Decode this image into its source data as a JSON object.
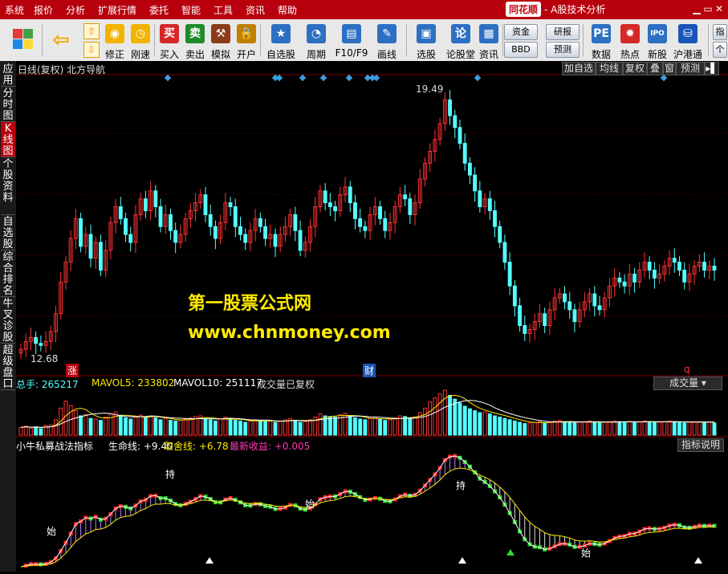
{
  "menubar": {
    "items": [
      "系统",
      "报价",
      "分析",
      "扩展行情",
      "委托",
      "智能",
      "工具",
      "资讯",
      "帮助"
    ],
    "brand_logo": "同花顺",
    "brand_sub": "- A股技术分析"
  },
  "toolbar": {
    "buttons": [
      "修正",
      "刚速",
      "买入",
      "卖出",
      "模拟",
      "开户",
      "自选股",
      "周期",
      "F10/F9",
      "画线",
      "选股",
      "论股堂",
      "资讯",
      "数据",
      "热点",
      "新股",
      "沪港通"
    ],
    "right_buttons": [
      "资金",
      "BBD",
      "研报",
      "预测"
    ],
    "buy_glyph": "买",
    "sell_glyph": "卖",
    "lun_glyph": "论"
  },
  "sidebar": {
    "tabs": [
      "应用",
      "分时图",
      "K线图",
      "个股资料",
      "自选股",
      "综合排名",
      "牛叉诊股",
      "超级盘口"
    ],
    "active_index": 2
  },
  "kline_panel": {
    "title": "日线(复权)  北方导航",
    "right_buttons": [
      "加自选",
      "均线",
      "复权",
      "叠",
      "窗",
      "预测"
    ],
    "high_label": "19.49",
    "low_label": "12.68",
    "marker_zhang": "涨",
    "marker_cai": "财",
    "marker_q": "q"
  },
  "volume_panel": {
    "label_total": "总手: 265217",
    "label_ma5": "MAVOL5: 233802",
    "label_ma10": "MAVOL10: 251117",
    "note": "成交量已复权",
    "dropdown": "成交量"
  },
  "indicator_panel": {
    "name": "小牛私募战法指标",
    "life_line": "生命线: +9.40",
    "exit_line": "取舍线: +6.78",
    "profit": "最新收益: +0.005",
    "help_button": "指标说明",
    "label_hold": "持",
    "label_start": "始"
  },
  "watermark": {
    "line1": "第一股票公式网",
    "line2": "www.chnmoney.com"
  },
  "colors": {
    "up": "#ff3232",
    "down": "#54ffff",
    "menu_bg": "#b8000d",
    "accent_yellow": "#ffeb00"
  },
  "chart_data": {
    "type": "candlestick",
    "price_range": [
      12.68,
      19.49
    ],
    "closes": [
      12.9,
      13.1,
      13.2,
      13.05,
      13.0,
      13.1,
      13.35,
      13.8,
      14.6,
      15.1,
      15.7,
      16.2,
      15.5,
      15.8,
      15.2,
      15.6,
      14.9,
      15.4,
      16.1,
      16.5,
      16.2,
      15.8,
      15.6,
      16.3,
      16.7,
      16.4,
      16.9,
      16.5,
      16.0,
      16.3,
      15.9,
      15.6,
      15.8,
      16.2,
      16.4,
      16.6,
      16.8,
      16.3,
      16.0,
      15.7,
      16.1,
      16.6,
      16.5,
      16.0,
      15.8,
      15.6,
      15.9,
      16.2,
      16.0,
      15.7,
      15.8,
      15.5,
      15.8,
      16.0,
      16.3,
      15.9,
      15.4,
      15.6,
      16.0,
      16.5,
      16.9,
      16.6,
      16.5,
      16.4,
      16.8,
      17.0,
      16.6,
      16.2,
      16.0,
      15.9,
      16.3,
      16.5,
      16.2,
      15.9,
      16.1,
      16.5,
      16.8,
      16.7,
      16.3,
      16.6,
      17.2,
      17.6,
      17.9,
      18.2,
      18.6,
      19.2,
      18.8,
      18.5,
      18.1,
      17.6,
      17.3,
      16.9,
      16.5,
      16.7,
      16.4,
      16.0,
      15.6,
      15.1,
      14.5,
      14.0,
      13.5,
      13.3,
      13.4,
      13.6,
      13.8,
      13.5,
      13.9,
      14.2,
      14.3,
      14.1,
      13.9,
      13.6,
      13.9,
      14.1,
      14.3,
      14.0,
      13.9,
      14.2,
      14.5,
      14.7,
      14.6,
      14.5,
      14.8,
      14.6,
      14.9,
      15.1,
      14.9,
      14.7,
      14.8,
      15.0,
      15.2,
      15.1,
      14.9,
      14.6,
      14.8,
      15.0,
      15.1,
      14.9,
      15.0,
      14.9
    ],
    "volumes": [
      120,
      140,
      110,
      130,
      100,
      150,
      160,
      240,
      420,
      530,
      460,
      380,
      300,
      320,
      260,
      250,
      230,
      280,
      330,
      360,
      310,
      270,
      250,
      290,
      310,
      280,
      300,
      270,
      240,
      260,
      230,
      220,
      230,
      250,
      270,
      290,
      300,
      260,
      240,
      220,
      250,
      280,
      260,
      230,
      220,
      200,
      220,
      240,
      230,
      210,
      220,
      200,
      220,
      240,
      260,
      230,
      200,
      210,
      240,
      280,
      330,
      300,
      290,
      280,
      320,
      340,
      300,
      270,
      250,
      240,
      260,
      280,
      250,
      230,
      240,
      270,
      300,
      290,
      260,
      280,
      350,
      420,
      520,
      580,
      640,
      700,
      620,
      560,
      500,
      450,
      410,
      380,
      350,
      360,
      330,
      300,
      280,
      260,
      240,
      220,
      200,
      180,
      190,
      200,
      210,
      190,
      200,
      220,
      230,
      210,
      200,
      190,
      200,
      210,
      220,
      200,
      190,
      200,
      210,
      220,
      210,
      200,
      210,
      200,
      210,
      220,
      210,
      200,
      200,
      210,
      220,
      210,
      200,
      190,
      200,
      210,
      210,
      200,
      200,
      190
    ],
    "total_volume": 265217,
    "mavol5": 233802,
    "mavol10": 251117,
    "indicator_life_line": 9.4,
    "indicator_exit_line": 6.78,
    "latest_profit": 0.005
  }
}
